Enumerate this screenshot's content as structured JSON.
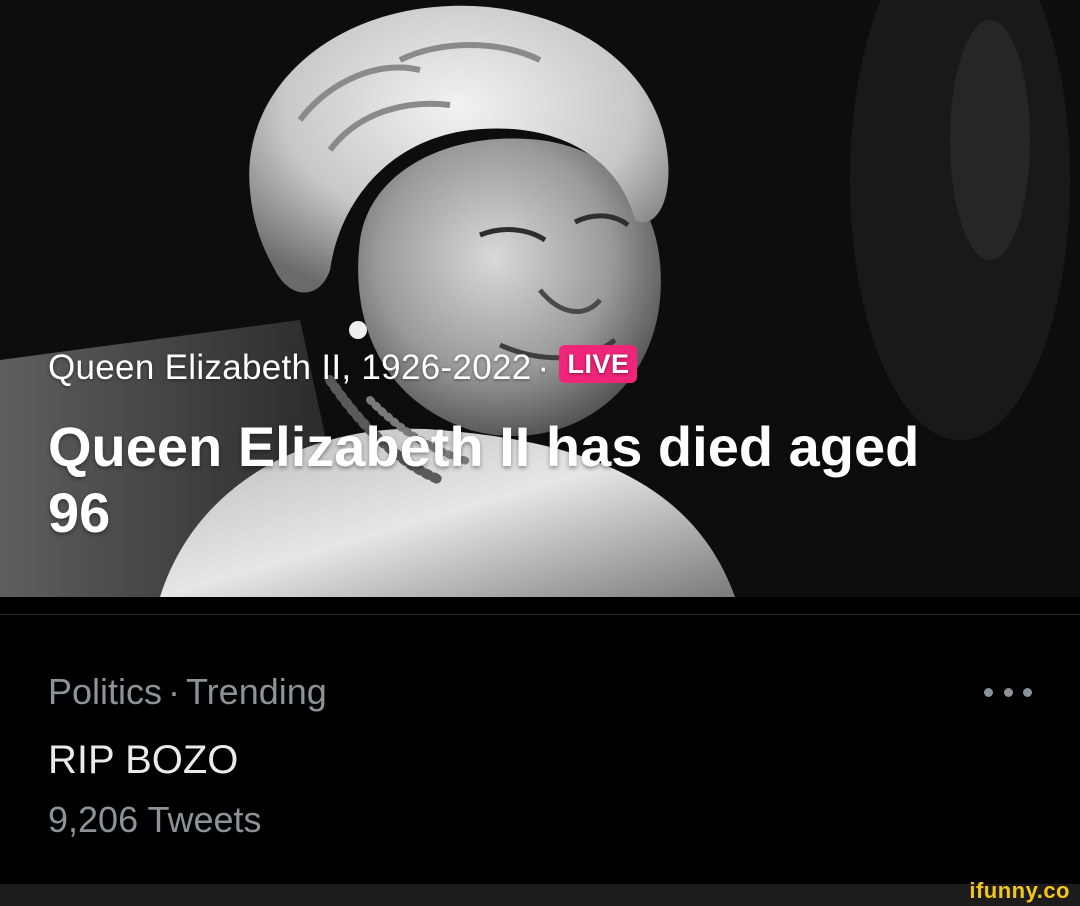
{
  "hero": {
    "subtitle_topic": "Queen Elizabeth II, 1926-2022",
    "subtitle_separator": "·",
    "live_badge": "LIVE",
    "headline": "Queen Elizabeth II has died aged 96",
    "image_icon": "portrait-photo-icon"
  },
  "trend": {
    "category": "Politics",
    "separator": "·",
    "status": "Trending",
    "title": "RIP BOZO",
    "tweet_count": "9,206 Tweets",
    "more_icon": "more-horizontal-icon"
  },
  "watermark": "ifunny.co",
  "colors": {
    "background": "#000000",
    "live_badge": "#f0257a",
    "secondary_text": "#8b9298",
    "primary_text": "#e9eaeb",
    "watermark": "#f5c518"
  }
}
